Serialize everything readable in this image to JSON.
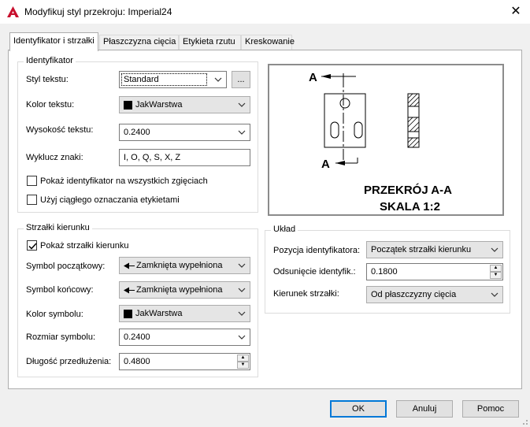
{
  "window": {
    "title": "Modyfikuj styl przekroju: Imperial24",
    "close_glyph": "✕"
  },
  "tabs": [
    {
      "label": "Identyfikator i strzałki",
      "active": true
    },
    {
      "label": "Płaszczyzna cięcia"
    },
    {
      "label": "Etykieta rzutu"
    },
    {
      "label": "Kreskowanie"
    }
  ],
  "identyfikator": {
    "group_label": "Identyfikator",
    "styl_tekstu": {
      "label": "Styl tekstu:",
      "value": "Standard",
      "browse": "..."
    },
    "kolor_tekstu": {
      "label": "Kolor tekstu:",
      "value": "JakWarstwa"
    },
    "wysokosc_tekstu": {
      "label": "Wysokość tekstu:",
      "value": "0.2400"
    },
    "wyklucz_znaki": {
      "label": "Wyklucz znaki:",
      "value": "I, O, Q, S, X, Z"
    },
    "pokaz_identyfikator": {
      "label": "Pokaż identyfikator na wszystkich zgięciach",
      "checked": false
    },
    "uzyj_ciaglego": {
      "label": "Użyj ciągłego oznaczania etykietami",
      "checked": false
    }
  },
  "strzalki": {
    "group_label": "Strzałki kierunku",
    "pokaz_strzalki": {
      "label": "Pokaż strzałki kierunku",
      "checked": true
    },
    "symbol_poczatkowy": {
      "label": "Symbol początkowy:",
      "value": "Zamknięta wypełniona"
    },
    "symbol_koncowy": {
      "label": "Symbol końcowy:",
      "value": "Zamknięta wypełniona"
    },
    "kolor_symbolu": {
      "label": "Kolor symbolu:",
      "value": "JakWarstwa"
    },
    "rozmiar_symbolu": {
      "label": "Rozmiar symbolu:",
      "value": "0.2400"
    },
    "dlugosc_przedluzenia": {
      "label": "Długość przedłużenia:",
      "value": "0.4800"
    }
  },
  "uklad": {
    "group_label": "Układ",
    "pozycja": {
      "label": "Pozycja identyfikatora:",
      "value": "Początek strzałki kierunku"
    },
    "odsuniecie": {
      "label": "Odsunięcie identyfik.:",
      "value": "0.1800"
    },
    "kierunek": {
      "label": "Kierunek strzałki:",
      "value": "Od płaszczyzny cięcia"
    }
  },
  "preview": {
    "marker_top": "A",
    "marker_bottom": "A",
    "title_line1": "PRZEKRÓJ A-A",
    "title_line2": "SKALA 1:2"
  },
  "buttons": {
    "ok": "OK",
    "cancel": "Anuluj",
    "help": "Pomoc"
  },
  "colors": {
    "autocad_red": "#c8102e",
    "focus_blue": "#0078d7"
  }
}
